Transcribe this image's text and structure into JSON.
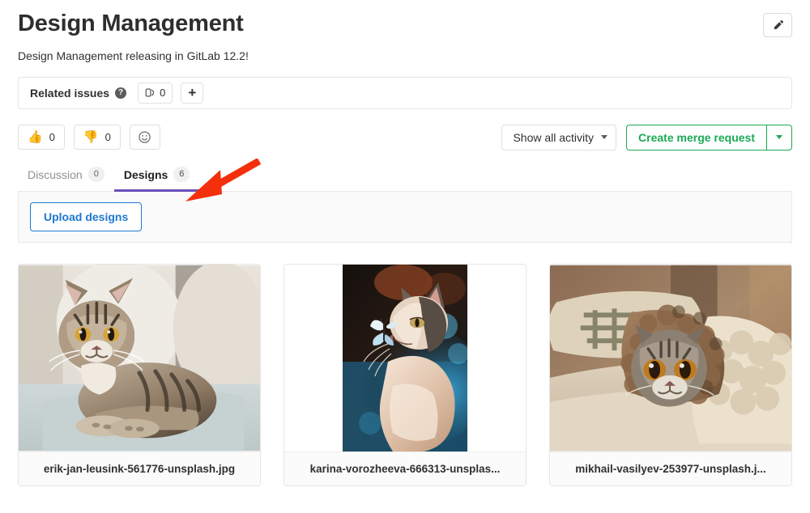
{
  "header": {
    "title": "Design Management",
    "subtitle": "Design Management releasing in GitLab 12.2!",
    "edit_icon": "pencil-icon"
  },
  "related_issues": {
    "label": "Related issues",
    "help_icon": "help-circle-icon",
    "help_glyph": "?",
    "issue_icon": "issue-link-icon",
    "count": "0",
    "add_label": "+"
  },
  "awards": {
    "thumbsup": {
      "emoji": "👍",
      "count": "0",
      "name": "thumbsup"
    },
    "thumbsdown": {
      "emoji": "👎",
      "count": "0",
      "name": "thumbsdown"
    },
    "picker_icon": "smiley-face-icon"
  },
  "activity": {
    "dropdown_label": "Show all activity",
    "caret_icon": "chevron-down-icon"
  },
  "merge_request": {
    "label": "Create merge request",
    "caret_icon": "chevron-down-icon",
    "accent_color": "#1aaa55"
  },
  "tabs": [
    {
      "label": "Discussion",
      "count": "0",
      "active": false
    },
    {
      "label": "Designs",
      "count": "6",
      "active": true
    }
  ],
  "tabs_meta": {
    "active_underline_color": "#6b4fbb"
  },
  "upload": {
    "button_label": "Upload designs",
    "accent_color": "#1f78d1"
  },
  "designs": [
    {
      "filename": "erik-jan-leusink-561776-unsplash.jpg",
      "image_alt": "tabby cat sitting on a light couch in front of cushions"
    },
    {
      "filename": "karina-vorozheeva-666313-unsplas...",
      "image_alt": "fluffy cat in profile with a butterfly on its nose, blue bokeh background"
    },
    {
      "filename": "mikhail-vasilyev-253977-unsplash.j...",
      "image_alt": "kitten peeking out from under a brown fluffy blanket"
    }
  ],
  "annotation": {
    "type": "arrow",
    "color": "#f42f0c",
    "points_to": "Designs tab"
  }
}
